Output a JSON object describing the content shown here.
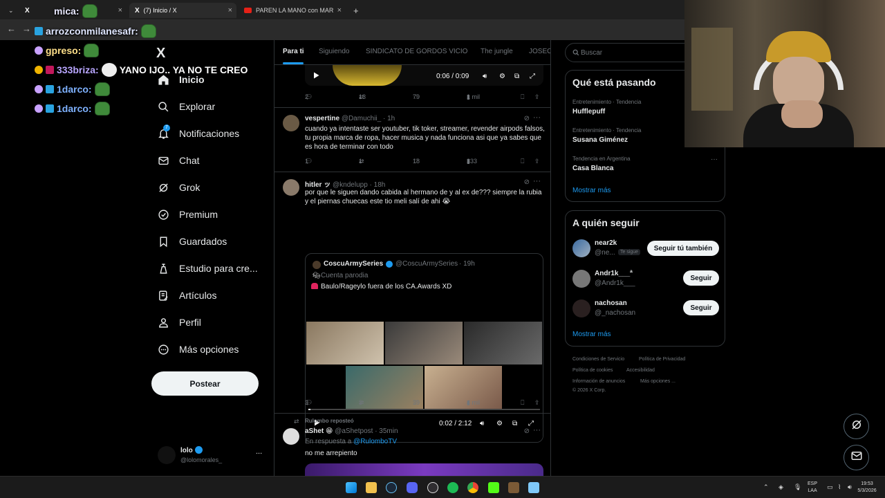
{
  "browser": {
    "tabs": [
      {
        "title": "(7) Inicio / X"
      },
      {
        "title": "PAREN LA MANO con MAR"
      }
    ],
    "new_tab": "+"
  },
  "chat_overlay": [
    {
      "user": "mica:",
      "text": ""
    },
    {
      "user": "arrozconmilanesafr:",
      "text": ""
    },
    {
      "user": "gpreso:",
      "text": ""
    },
    {
      "user": "333briza:",
      "text": "YANO IJO.. YA NO TE CREO"
    },
    {
      "user": "1darco:",
      "text": ""
    },
    {
      "user": "1darco:",
      "text": ""
    }
  ],
  "sidebar": {
    "logo": "X",
    "items": [
      {
        "label": "Inicio"
      },
      {
        "label": "Explorar"
      },
      {
        "label": "Notificaciones",
        "badge": "7"
      },
      {
        "label": "Chat"
      },
      {
        "label": "Grok"
      },
      {
        "label": "Premium"
      },
      {
        "label": "Guardados"
      },
      {
        "label": "Estudio para cre..."
      },
      {
        "label": "Artículos"
      },
      {
        "label": "Perfil"
      },
      {
        "label": "Más opciones"
      }
    ],
    "post_button": "Postear",
    "account": {
      "name": "lolo",
      "handle": "@lolomorales_",
      "more": "..."
    }
  },
  "timeline": {
    "tabs": [
      "Para ti",
      "Siguiendo",
      "SINDICATO DE GORDOS VICIO",
      "The jungle",
      "JOSEO"
    ],
    "top_video": {
      "time": "0:06 / 0:09"
    },
    "top_metrics": {
      "replies": "2",
      "reposts": "13",
      "likes": "79",
      "views": "1 mil"
    },
    "tweets": [
      {
        "name": "vespertine",
        "handle": "@Damuchii_",
        "time": "· 1h",
        "text": "cuando ya intentaste ser youtuber, tik toker, streamer, revender airpods falsos, tu propia marca de ropa, hacer musica y nada funciona asi que ya sabes que es hora de terminar con todo",
        "replies": "1",
        "reposts": "1",
        "likes": "18",
        "views": "333"
      },
      {
        "name": "hitler ッ",
        "handle": "@kndelupp",
        "time": "· 18h",
        "text": "por que le siguen dando cabida al hermano de y al ex de??? siempre la rubia y el piernas chuecas este tio meli salí de ahi 😭",
        "quote": {
          "name": "CoscuArmySeries",
          "handle": "@CoscuArmySeries",
          "time": "· 19h",
          "label": "Cuenta parodia",
          "text": "Baulo/Rageylo fuera de los CA.Awards  XD",
          "video_time": "0:02 / 2:12"
        },
        "replies": "3",
        "reposts": "3",
        "likes": "39",
        "views": "4 mil"
      },
      {
        "repost_by": "Rulombo reposteó",
        "name": "aShet 😁",
        "handle": "@aShetpost",
        "time": "· 35min",
        "reply_prefix": "En respuesta a",
        "reply_to": "@RulomboTV",
        "text": "no me arrepiento"
      }
    ]
  },
  "right": {
    "search_placeholder": "Buscar",
    "trends_title": "Qué está pasando",
    "trends": [
      {
        "meta": "Entretenimiento · Tendencia",
        "name": "Hufflepuff"
      },
      {
        "meta": "Entretenimiento · Tendencia",
        "name": "Susana Giménez"
      },
      {
        "meta": "Tendencia en Argentina",
        "name": "Casa Blanca"
      }
    ],
    "trends_more": "Mostrar más",
    "follow_title": "A quién seguir",
    "follow": [
      {
        "name": "near2k",
        "handle": "@ne...",
        "follows_you": "Te sigue",
        "button": "Seguir tú también"
      },
      {
        "name": "Andr1k___ª",
        "handle": "@Andr1k___",
        "button": "Seguir"
      },
      {
        "name": "nachosan",
        "handle": "@_nachosan",
        "button": "Seguir"
      }
    ],
    "follow_more": "Mostrar más",
    "footer": [
      "Condiciones de Servicio",
      "Política de Privacidad",
      "Política de cookies",
      "Accesibilidad",
      "Información de anuncios",
      "Más opciones ...",
      "© 2026 X Corp."
    ]
  },
  "taskbar": {
    "lang": "ESP",
    "lang2": "LAA",
    "time": "19:53",
    "date": "5/3/2026"
  },
  "colors": {
    "accent": "#1d9bf0",
    "background": "#000000",
    "border": "#2f3336",
    "muted": "#71767b"
  }
}
